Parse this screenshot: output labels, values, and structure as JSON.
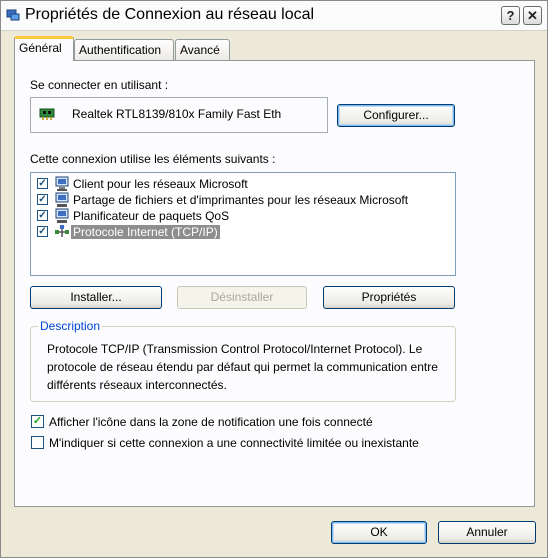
{
  "window": {
    "title": "Propriétés de Connexion au réseau local",
    "help_btn": "?",
    "close_btn": "✕"
  },
  "tabs": [
    {
      "label": "Général",
      "active": true
    },
    {
      "label": "Authentification",
      "active": false
    },
    {
      "label": "Avancé",
      "active": false
    }
  ],
  "connect_using": {
    "label": "Se connecter en utilisant :",
    "adapter": "Realtek RTL8139/810x Family Fast Eth",
    "configure_button": "Configurer..."
  },
  "components": {
    "label": "Cette connexion utilise les éléments suivants :",
    "items": [
      {
        "label": "Client pour les réseaux Microsoft",
        "checked": true,
        "icon": "network-client-icon"
      },
      {
        "label": "Partage de fichiers et d'imprimantes pour les réseaux Microsoft",
        "checked": true,
        "icon": "file-printer-sharing-icon"
      },
      {
        "label": "Planificateur de paquets QoS",
        "checked": true,
        "icon": "qos-scheduler-icon"
      },
      {
        "label": "Protocole Internet (TCP/IP)",
        "checked": true,
        "selected": true,
        "icon": "protocol-icon"
      }
    ]
  },
  "buttons": {
    "install": "Installer...",
    "uninstall": "Désinstaller",
    "properties": "Propriétés"
  },
  "description": {
    "title": "Description",
    "text": "Protocole TCP/IP (Transmission Control Protocol/Internet Protocol). Le protocole de réseau étendu par défaut qui permet la communication entre différents réseaux interconnectés."
  },
  "options": {
    "show_icon": {
      "label": "Afficher l'icône dans la zone de notification une fois connecté",
      "checked": true
    },
    "notify_limited": {
      "label": "M'indiquer si cette connexion a une connectivité limitée ou inexistante",
      "checked": false
    }
  },
  "footer": {
    "ok": "OK",
    "cancel": "Annuler"
  },
  "colors": {
    "face": "#ece9d8",
    "panel": "#fcfcfe",
    "tab_highlight": "#ffc83c",
    "group_title": "#0046d5"
  }
}
